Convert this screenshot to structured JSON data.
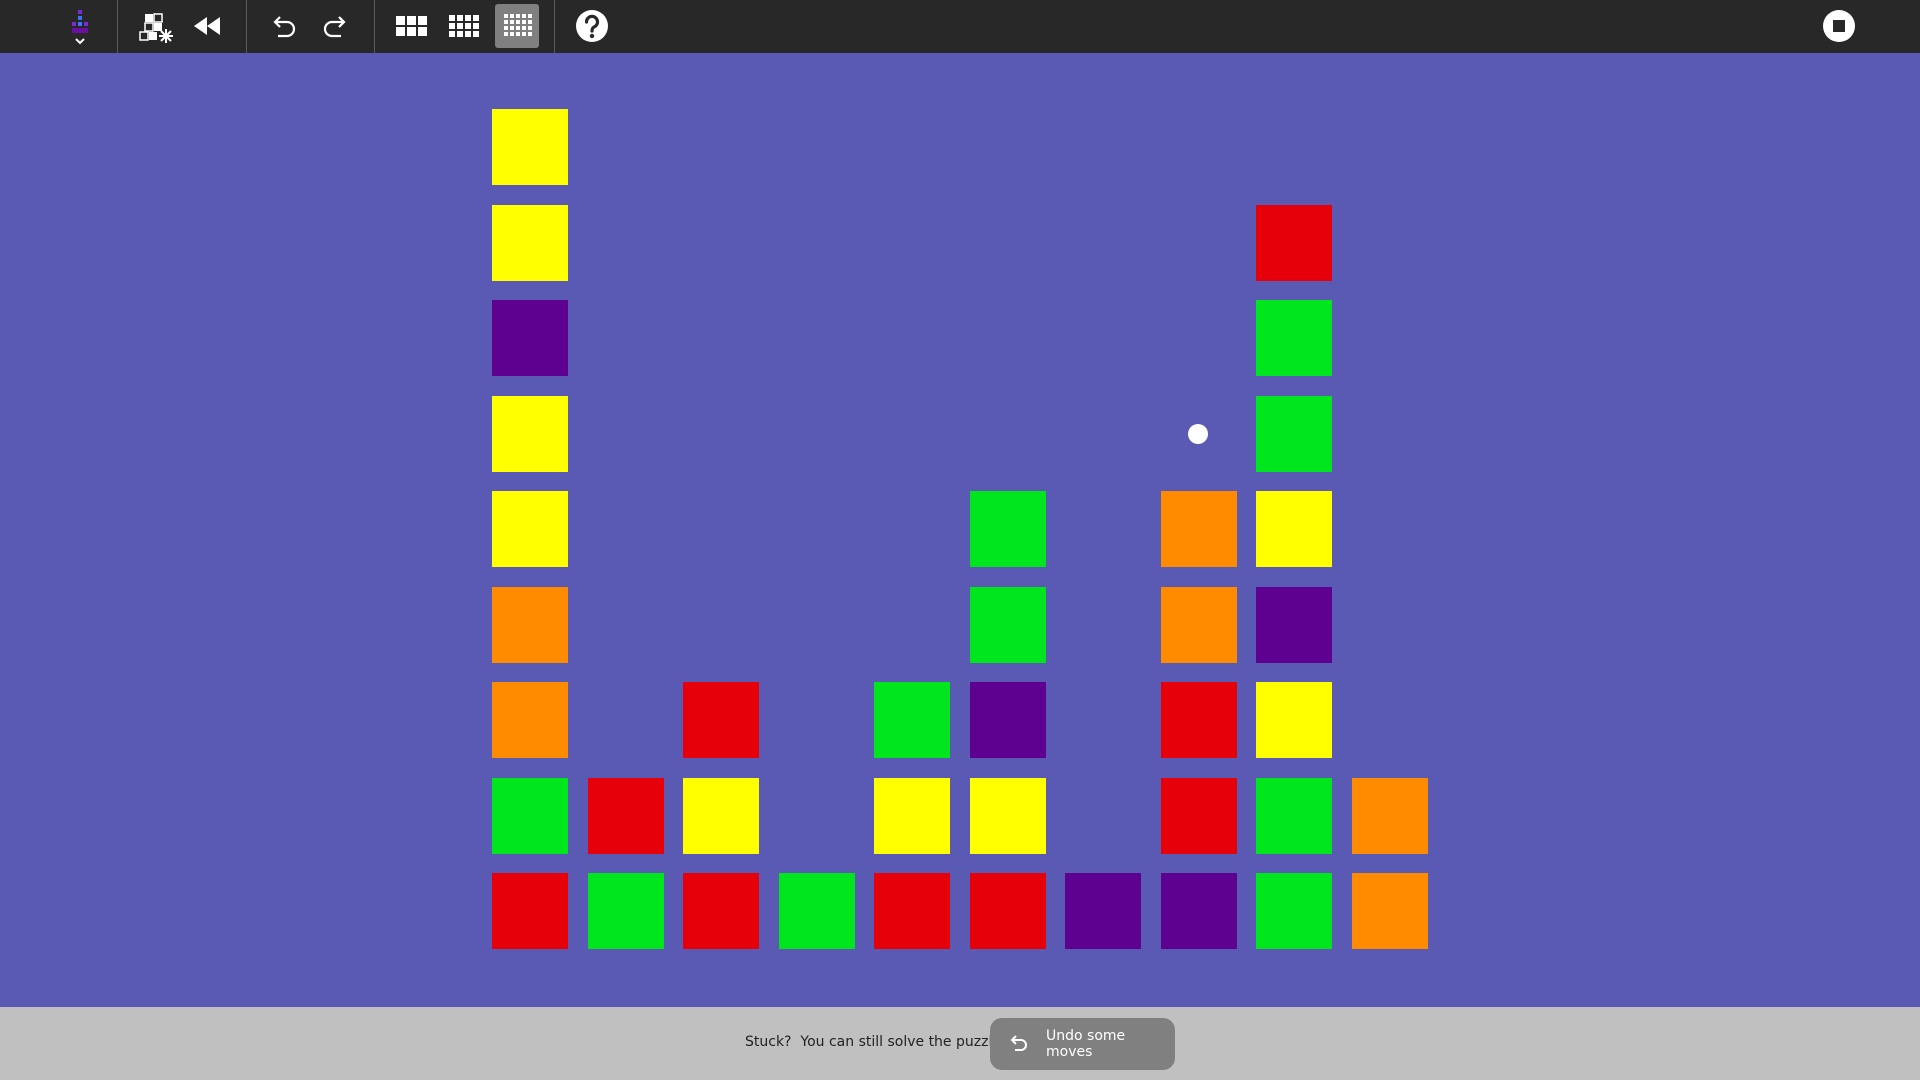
{
  "toolbar": {
    "icons": {
      "activity": "activity-icon",
      "new_game": "new-game-icon",
      "restart": "rewind-icon",
      "undo": "undo-icon",
      "redo": "redo-icon",
      "small_board": "grid-small-icon",
      "medium_board": "grid-medium-icon",
      "large_board": "grid-large-icon",
      "help": "help-icon",
      "stop": "stop-icon"
    },
    "selected_board_size": "large",
    "background_color": "#282828"
  },
  "board": {
    "background_color": "#5a5ab4",
    "palette": {
      "Y": "#ffff00",
      "P": "#5e0090",
      "O": "#ff8c00",
      "G": "#00e61e",
      "R": "#e6000a"
    },
    "columns": [
      [
        "R",
        "G",
        "O",
        "O",
        "Y",
        "Y",
        "P",
        "Y",
        "Y"
      ],
      [
        "G",
        "R"
      ],
      [
        "R",
        "Y",
        "R"
      ],
      [
        "G"
      ],
      [
        "R",
        "Y",
        "G"
      ],
      [
        "R",
        "Y",
        "P",
        "G",
        "G"
      ],
      [
        "P"
      ],
      [
        "P",
        "R",
        "R",
        "O",
        "O"
      ],
      [
        "G",
        "G",
        "Y",
        "P",
        "Y",
        "G",
        "G",
        "R"
      ],
      [
        "O",
        "O"
      ]
    ]
  },
  "bottom_bar": {
    "message": "Stuck?  You can still solve the puzzle.",
    "undo_button_label": "Undo some moves",
    "undo_button_icon": "undo-icon"
  }
}
